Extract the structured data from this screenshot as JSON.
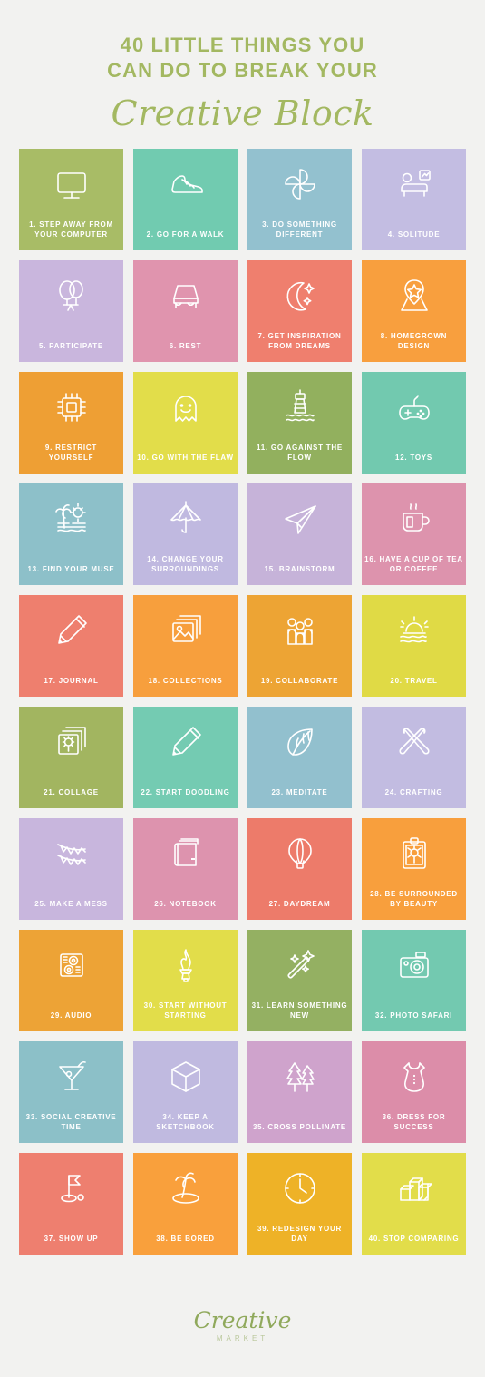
{
  "header": {
    "line1": "40 LITTLE THINGS YOU",
    "line2": "CAN DO TO BREAK  YOUR",
    "script": "Creative Block",
    "color": "#a3b861"
  },
  "footer": {
    "brand": "Creative",
    "sub": "MARKET",
    "brand_color": "#90a95c"
  },
  "background": "#f2f2f0",
  "tiles": [
    {
      "num": "1.",
      "label": "1. STEP AWAY FROM YOUR COMPUTER",
      "icon": "monitor-icon",
      "color": "#a8bc66"
    },
    {
      "num": "2.",
      "label": "2. GO FOR A WALK",
      "icon": "sneaker-icon",
      "color": "#71cbb0"
    },
    {
      "num": "3.",
      "label": "3. DO SOMETHING DIFFERENT",
      "icon": "pinwheel-icon",
      "color": "#93c1cf"
    },
    {
      "num": "4.",
      "label": "4. SOLITUDE",
      "icon": "sofa-icon",
      "color": "#c3bde2"
    },
    {
      "num": "5.",
      "label": "5. PARTICIPATE",
      "icon": "balloons-icon",
      "color": "#c9b6dd"
    },
    {
      "num": "6.",
      "label": "6. REST",
      "icon": "bed-icon",
      "color": "#e094ae"
    },
    {
      "num": "7.",
      "label": "7. GET INSPIRATION FROM DREAMS",
      "icon": "moon-stars-icon",
      "color": "#ef7f6e"
    },
    {
      "num": "8.",
      "label": "8. HOMEGROWN DESIGN",
      "icon": "map-pin-star-icon",
      "color": "#f89f3e"
    },
    {
      "num": "9.",
      "label": "9. RESTRICT YOURSELF",
      "icon": "cpu-chip-icon",
      "color": "#ee9f34"
    },
    {
      "num": "10.",
      "label": "10. GO WITH THE FLAW",
      "icon": "ghost-icon",
      "color": "#e2dd4a"
    },
    {
      "num": "11.",
      "label": "11. GO AGAINST THE FLOW",
      "icon": "lighthouse-icon",
      "color": "#92b05e"
    },
    {
      "num": "12.",
      "label": "12. TOYS",
      "icon": "gamepad-icon",
      "color": "#72c9af"
    },
    {
      "num": "13.",
      "label": "13. FIND YOUR MUSE",
      "icon": "beach-scene-icon",
      "color": "#8dc0c9"
    },
    {
      "num": "14.",
      "label": "14. CHANGE YOUR SURROUNDINGS",
      "icon": "umbrella-icon",
      "color": "#c0b9e0"
    },
    {
      "num": "15.",
      "label": "15. BRAINSTORM",
      "icon": "paper-plane-icon",
      "color": "#c6b3d9"
    },
    {
      "num": "16.",
      "label": "16. HAVE A CUP OF TEA OR COFFEE",
      "icon": "coffee-mug-icon",
      "color": "#dd93ad"
    },
    {
      "num": "17.",
      "label": "17. JOURNAL",
      "icon": "pencil-icon",
      "color": "#ee7f6e"
    },
    {
      "num": "18.",
      "label": "18. COLLECTIONS",
      "icon": "photo-stack-icon",
      "color": "#f79f3d"
    },
    {
      "num": "19.",
      "label": "19. COLLABORATE",
      "icon": "people-group-icon",
      "color": "#eda434"
    },
    {
      "num": "20.",
      "label": "20. TRAVEL",
      "icon": "sunset-sea-icon",
      "color": "#e0da45"
    },
    {
      "num": "21.",
      "label": "21. COLLAGE",
      "icon": "flower-frames-icon",
      "color": "#a2b560"
    },
    {
      "num": "22.",
      "label": "22. START DOODLING",
      "icon": "pencil-icon",
      "color": "#74cbb2"
    },
    {
      "num": "23.",
      "label": "23. MEDITATE",
      "icon": "leaf-icon",
      "color": "#92c0ce"
    },
    {
      "num": "24.",
      "label": "24. CRAFTING",
      "icon": "pen-brush-cross-icon",
      "color": "#c2bce1"
    },
    {
      "num": "25.",
      "label": "25. MAKE A MESS",
      "icon": "bunting-icon",
      "color": "#c8b6dd"
    },
    {
      "num": "26.",
      "label": "26. NOTEBOOK",
      "icon": "notebook-icon",
      "color": "#dd93ae"
    },
    {
      "num": "27.",
      "label": "27. DAYDREAM",
      "icon": "hot-air-balloon-icon",
      "color": "#ed7b6a"
    },
    {
      "num": "28.",
      "label": "28. BE SURROUNDED BY BEAUTY",
      "icon": "clipboard-flower-icon",
      "color": "#f89f3d"
    },
    {
      "num": "29.",
      "label": "29. AUDIO",
      "icon": "speaker-icon",
      "color": "#eda336"
    },
    {
      "num": "30.",
      "label": "30. START WITHOUT STARTING",
      "icon": "torch-flame-icon",
      "color": "#e2dd4a"
    },
    {
      "num": "31.",
      "label": "31. LEARN SOMETHING NEW",
      "icon": "magic-wand-icon",
      "color": "#94b062"
    },
    {
      "num": "32.",
      "label": "32. PHOTO SAFARI",
      "icon": "camera-icon",
      "color": "#73c9b0"
    },
    {
      "num": "33.",
      "label": "33. SOCIAL CREATIVE TIME",
      "icon": "cocktail-icon",
      "color": "#8cc0c8"
    },
    {
      "num": "34.",
      "label": "34. KEEP A SKETCHBOOK",
      "icon": "cube-icon",
      "color": "#c0bae0"
    },
    {
      "num": "35.",
      "label": "35. CROSS POLLINATE",
      "icon": "pine-trees-icon",
      "color": "#cfa3cc"
    },
    {
      "num": "36.",
      "label": "36. DRESS FOR SUCCESS",
      "icon": "dress-icon",
      "color": "#dc8da9"
    },
    {
      "num": "37.",
      "label": "37. SHOW UP",
      "icon": "golf-flag-icon",
      "color": "#ee7f6f"
    },
    {
      "num": "38.",
      "label": "38. BE BORED",
      "icon": "palm-island-icon",
      "color": "#f9a03c"
    },
    {
      "num": "39.",
      "label": "39. REDESIGN YOUR DAY",
      "icon": "clock-icon",
      "color": "#eeb227"
    },
    {
      "num": "40.",
      "label": "40. STOP COMPARING",
      "icon": "podium-icon",
      "color": "#e2dd4a"
    }
  ]
}
